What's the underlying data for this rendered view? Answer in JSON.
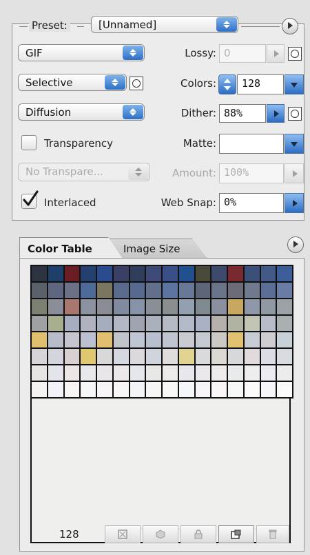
{
  "settings": {
    "preset_label": "Preset:",
    "preset_value": "[Unnamed]",
    "format_value": "GIF",
    "lossy_label": "Lossy:",
    "lossy_value": "0",
    "reduction_value": "Selective",
    "colors_label": "Colors:",
    "colors_value": "128",
    "dither_algo_value": "Diffusion",
    "dither_label": "Dither:",
    "dither_value": "88%",
    "transparency_label": "Transparency",
    "transparency_checked": false,
    "matte_label": "Matte:",
    "matte_value": "",
    "transparency_dither_value": "No Transpare...",
    "amount_label": "Amount:",
    "amount_value": "100%",
    "interlaced_label": "Interlaced",
    "interlaced_checked": true,
    "websnap_label": "Web Snap:",
    "websnap_value": "0%"
  },
  "color_panel": {
    "tabs": [
      {
        "label": "Color Table",
        "active": true
      },
      {
        "label": "Image Size",
        "active": false
      }
    ],
    "color_count": "128",
    "swatches": [
      [
        "#2b3340",
        "#1e3f6a",
        "#6b1d24",
        "#24406e",
        "#2a4c8f",
        "#3b3f66",
        "#2e3d5c",
        "#3d4a78",
        "#3a4f88",
        "#22508e",
        "#4a4a3a",
        "#3e4a6c",
        "#7a2a2e",
        "#3a5078",
        "#445a86",
        "#3c5e98"
      ],
      [
        "#5a6068",
        "#5f6680",
        "#6c7088",
        "#4e6a98",
        "#7a7660",
        "#5a6a8c",
        "#566a90",
        "#62708e",
        "#5e74a0",
        "#6a7898",
        "#5c6678",
        "#6a7488",
        "#6c6c78",
        "#707a8c",
        "#5c6e96",
        "#6a7ca4"
      ],
      [
        "#7c8070",
        "#8a8e98",
        "#a87870",
        "#8a92a2",
        "#8a8c94",
        "#808aa0",
        "#8692a8",
        "#8a8e96",
        "#8a8e90",
        "#92a0b0",
        "#7e8a90",
        "#8a909e",
        "#c8a860",
        "#8e98a8",
        "#9098a4",
        "#9aa2a8"
      ],
      [
        "#9ea2a4",
        "#a8ae90",
        "#a6aec0",
        "#b0b2c0",
        "#a4aebc",
        "#b2b8c6",
        "#a0a4b0",
        "#aab0bc",
        "#b6bac2",
        "#b2bac8",
        "#a8b2c4",
        "#b6b0ac",
        "#b0b2a2",
        "#c2c4b4",
        "#b8bcc8",
        "#aab0b2"
      ],
      [
        "#e0c070",
        "#b8bcc8",
        "#c6c4cc",
        "#bcc0d0",
        "#e0c070",
        "#c2c4cc",
        "#c0c6d4",
        "#b8c0d0",
        "#c0c4d0",
        "#c8ccd0",
        "#c6cad2",
        "#ccc8c4",
        "#e0c270",
        "#c8ccd4",
        "#d0ccd2",
        "#c8d0d8"
      ],
      [
        "#d8d4d8",
        "#d4d4dc",
        "#d8d0d0",
        "#e0c870",
        "#d8d8d8",
        "#d4d6e0",
        "#dcd8dc",
        "#d0d4dc",
        "#e0dcdc",
        "#e0d490",
        "#d8dade",
        "#dcd8d4",
        "#d6d8dc",
        "#e0dadc",
        "#dcdce4",
        "#d8dce0"
      ],
      [
        "#e8e4e4",
        "#e4e4ec",
        "#ece6e6",
        "#e6e8ec",
        "#e8e6ea",
        "#ece8ea",
        "#e4e6ec",
        "#e8e8e6",
        "#ecebe8",
        "#e6e8ee",
        "#eae8ec",
        "#eeeaea",
        "#e8eaec",
        "#eeeeee",
        "#eaeaf0",
        "#ececec"
      ],
      [
        "#f6f2f2",
        "#f2f2f8",
        "#f8f4f4",
        "#f4f6f8",
        "#f6f4f6",
        "#f8f6f6",
        "#f2f4f8",
        "#f6f6f4",
        "#f8f8f6",
        "#f4f6fa",
        "#f6f4f8",
        "#faf6f6",
        "#f6f8f8",
        "#fbfbfb",
        "#f6f6fa",
        "#fafafa"
      ]
    ],
    "footer_icons": [
      "map-to-web-icon",
      "lock-color-icon",
      "shift-icon",
      "new-color-icon",
      "trash-icon"
    ]
  },
  "colors": {
    "accent_blue": "#2b6cc4",
    "grid_border": "#111111"
  }
}
